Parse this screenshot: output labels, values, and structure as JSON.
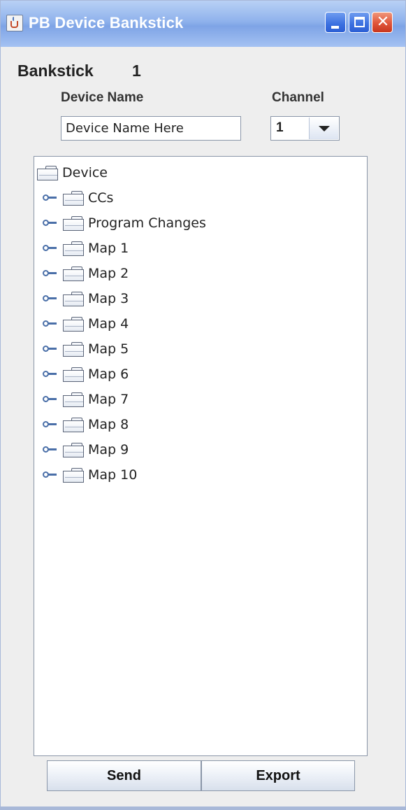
{
  "window": {
    "title": "PB Device Bankstick",
    "icon": "java-cup-icon",
    "controls": [
      "minimize",
      "maximize",
      "close"
    ]
  },
  "header": {
    "bank_label": "Bankstick",
    "bank_number": "1"
  },
  "fields": {
    "device_name_label": "Device Name",
    "device_name_value": "Device Name Here",
    "channel_label": "Channel",
    "channel_value": "1"
  },
  "tree": {
    "root": "Device",
    "children": [
      "CCs",
      "Program Changes",
      "Map 1",
      "Map 2",
      "Map 3",
      "Map 4",
      "Map 5",
      "Map 6",
      "Map 7",
      "Map 8",
      "Map 9",
      "Map 10"
    ]
  },
  "actions": {
    "send_label": "Send",
    "export_label": "Export"
  }
}
